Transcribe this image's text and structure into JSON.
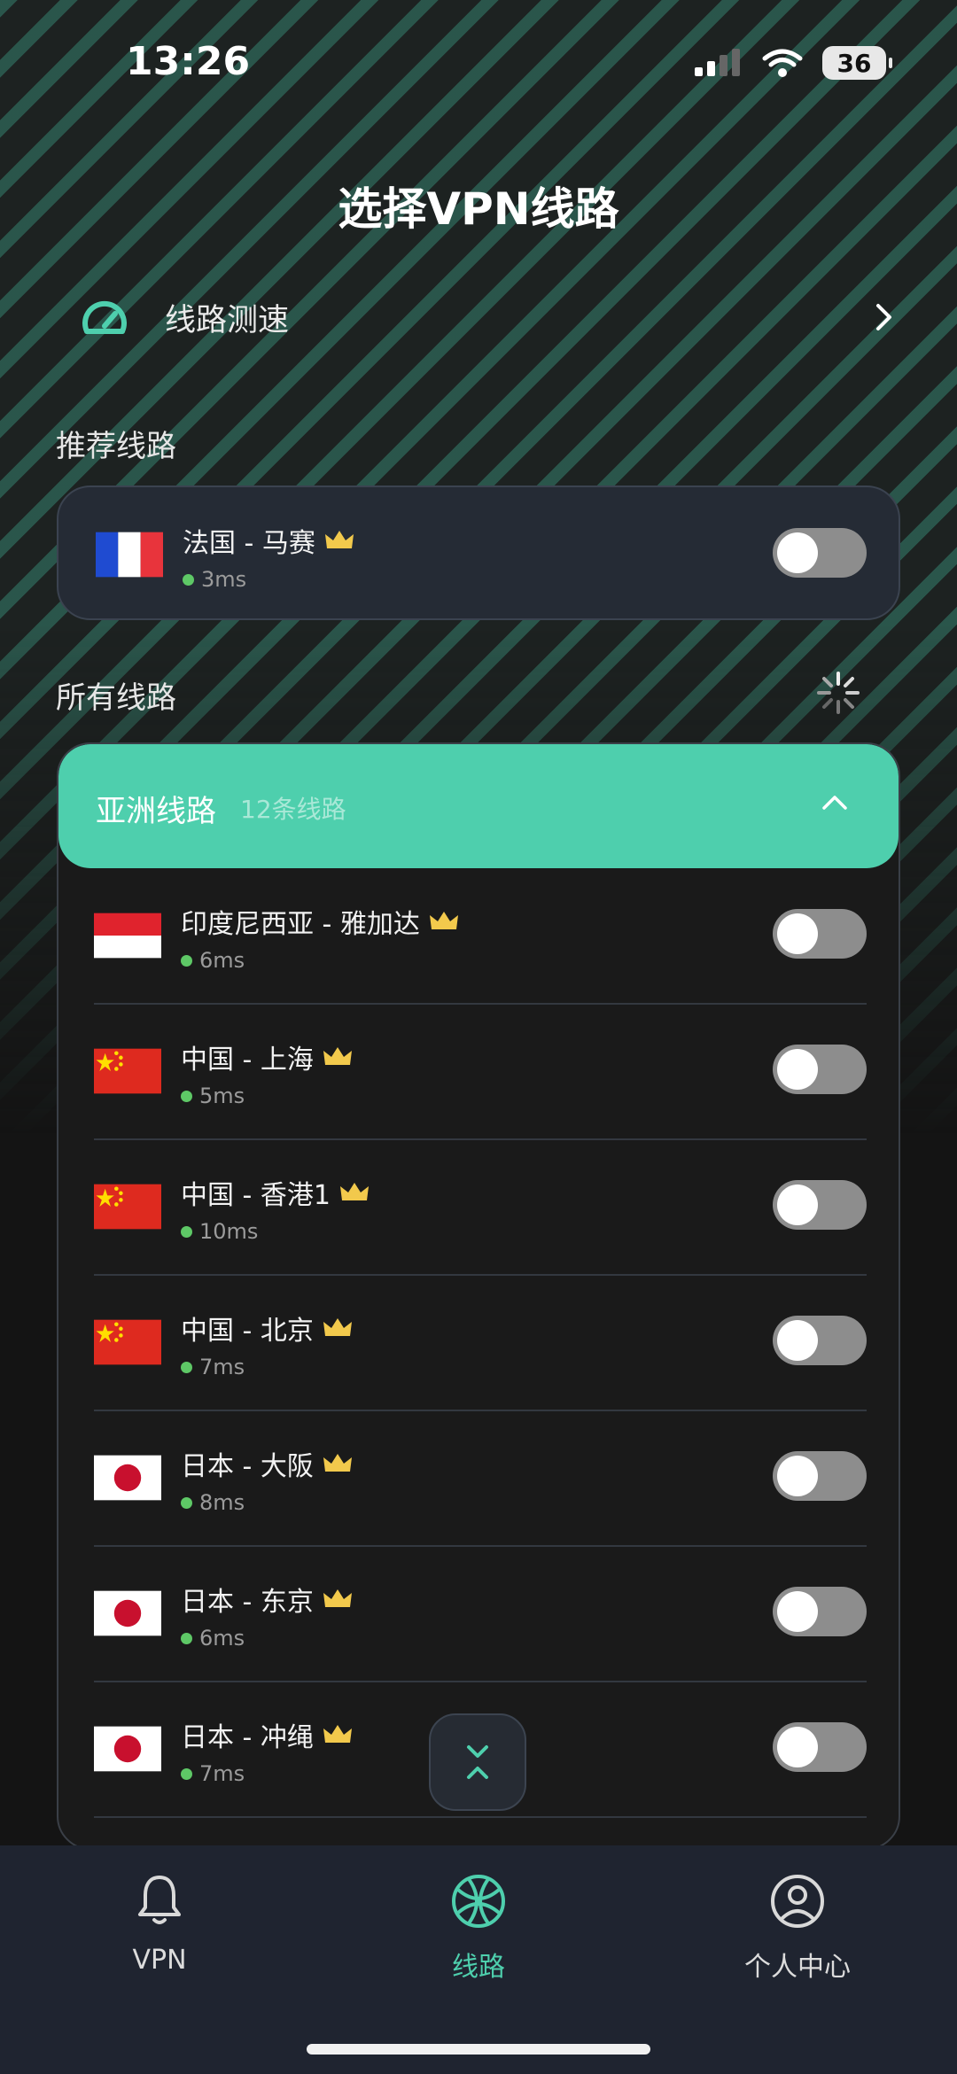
{
  "status_bar": {
    "time": "13:26",
    "battery": "36"
  },
  "page_title": "选择VPN线路",
  "speed_test": {
    "label": "线路测速"
  },
  "recommended": {
    "section_label": "推荐线路",
    "item": {
      "name": "法国 - 马赛",
      "latency": "3ms",
      "flag": "france",
      "premium": true,
      "enabled": false
    }
  },
  "all_lines": {
    "section_label": "所有线路",
    "region": {
      "title": "亚洲线路",
      "count": "12条线路",
      "expanded": true,
      "items": [
        {
          "name": "印度尼西亚 - 雅加达",
          "latency": "6ms",
          "flag": "indonesia",
          "enabled": false
        },
        {
          "name": "中国 - 上海",
          "latency": "5ms",
          "flag": "china",
          "enabled": false
        },
        {
          "name": "中国 - 香港1",
          "latency": "10ms",
          "flag": "china",
          "enabled": false
        },
        {
          "name": "中国 - 北京",
          "latency": "7ms",
          "flag": "china",
          "enabled": false
        },
        {
          "name": "日本 - 大阪",
          "latency": "8ms",
          "flag": "japan",
          "enabled": false
        },
        {
          "name": "日本 - 东京",
          "latency": "6ms",
          "flag": "japan",
          "enabled": false
        },
        {
          "name": "日本 - 冲绳",
          "latency": "7ms",
          "flag": "japan",
          "enabled": false
        }
      ]
    }
  },
  "bottom_nav": {
    "tabs": [
      {
        "label": "VPN",
        "icon": "bell-icon",
        "active": false
      },
      {
        "label": "线路",
        "icon": "globe-icon",
        "active": true
      },
      {
        "label": "个人中心",
        "icon": "profile-icon",
        "active": false
      }
    ]
  },
  "colors": {
    "accent": "#4ecfad",
    "latency_dot": "#5ec866",
    "crown": "#f2c94c",
    "card": "#252b35",
    "nav": "#1f2430"
  }
}
